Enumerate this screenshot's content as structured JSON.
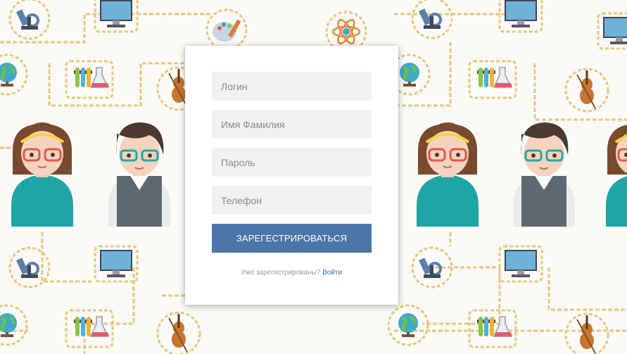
{
  "form": {
    "login_placeholder": "Логин",
    "name_placeholder": "Имя Фамилия",
    "password_placeholder": "Пароль",
    "phone_placeholder": "Телефон",
    "submit_label": "ЗАРЕГЕСТРИРОВАТЬСЯ",
    "already_text": "Уже зарегистрированы?",
    "login_link": "Войти"
  },
  "colors": {
    "button": "#4a76a8",
    "link": "#2e6da4",
    "field_bg": "#f1f1f1",
    "page_bg": "#fbfaf6",
    "chain": "#e3c97e"
  },
  "background_icons": [
    "microscope-icon",
    "computer-icon",
    "palette-icon",
    "atom-icon",
    "globe-icon",
    "test-tubes-icon",
    "violin-icon",
    "girl-avatar",
    "boy-avatar"
  ]
}
